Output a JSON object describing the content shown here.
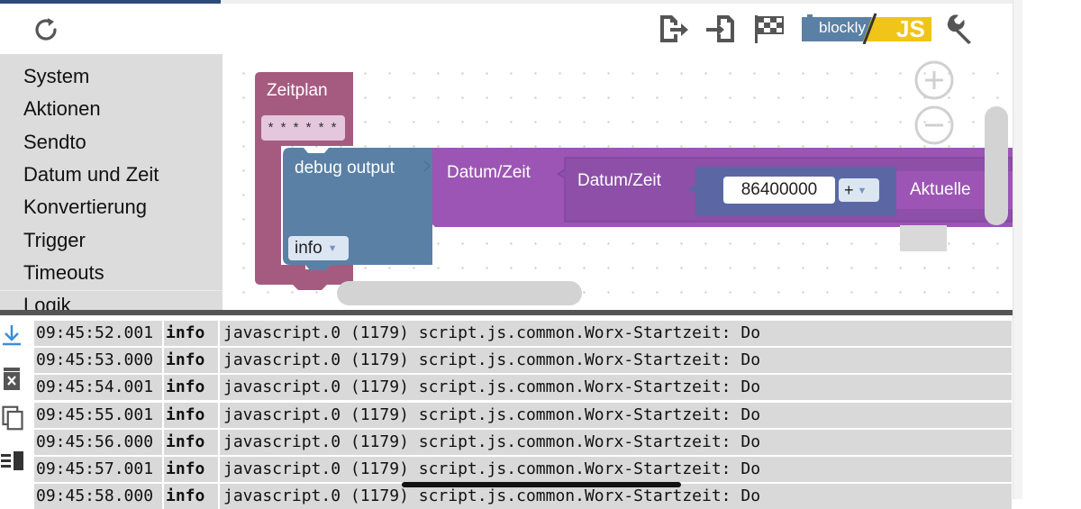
{
  "colors": {
    "zeitplan_block": "#a55b80",
    "debug_block": "#5b80a5",
    "datum_block": "#9c55b4",
    "datum_inner_block": "#8d4fa8",
    "math_block": "#5b67a5",
    "log_row_bg": "#d9d9d9",
    "sidebar_bg": "#dcdcdc",
    "blockly_badge": "#5b80a5",
    "js_badge": "#f0c419"
  },
  "toolbar": {
    "icons": [
      "refresh-icon",
      "export-icon",
      "import-icon",
      "checkered-flag-icon",
      "blockly-js-toggle-icon",
      "wrench-icon"
    ],
    "blockly_label": "blockly",
    "js_label": "JS"
  },
  "sidebar": {
    "items": [
      {
        "label": "System"
      },
      {
        "label": "Aktionen"
      },
      {
        "label": "Sendto"
      },
      {
        "label": "Datum und Zeit"
      },
      {
        "label": "Konvertierung"
      },
      {
        "label": "Trigger"
      },
      {
        "label": "Timeouts"
      },
      {
        "label": "Logik"
      }
    ]
  },
  "workspace": {
    "zeitplan": {
      "label": "Zeitplan",
      "cron": "* * * * * *"
    },
    "debug": {
      "label": "debug output",
      "level": "info"
    },
    "datum_outer": {
      "label": "Datum/Zeit"
    },
    "datum_inner": {
      "label": "Datum/Zeit"
    },
    "number": "86400000",
    "operator": "+",
    "aktuelle": {
      "label": "Aktuelle"
    }
  },
  "log": {
    "icons": [
      "scroll-down-icon",
      "clear-log-icon",
      "copy-icon",
      "toggle-view-icon"
    ],
    "rows": [
      {
        "time": "09:45:52.001",
        "level": "info",
        "message": "javascript.0 (1179) script.js.common.Worx-Startzeit: Do"
      },
      {
        "time": "09:45:53.000",
        "level": "info",
        "message": "javascript.0 (1179) script.js.common.Worx-Startzeit: Do"
      },
      {
        "time": "09:45:54.001",
        "level": "info",
        "message": "javascript.0 (1179) script.js.common.Worx-Startzeit: Do"
      },
      {
        "time": "09:45:55.001",
        "level": "info",
        "message": "javascript.0 (1179) script.js.common.Worx-Startzeit: Do"
      },
      {
        "time": "09:45:56.000",
        "level": "info",
        "message": "javascript.0 (1179) script.js.common.Worx-Startzeit: Do"
      },
      {
        "time": "09:45:57.001",
        "level": "info",
        "message": "javascript.0 (1179) script.js.common.Worx-Startzeit: Do"
      },
      {
        "time": "09:45:58.000",
        "level": "info",
        "message": "javascript.0 (1179) script.js.common.Worx-Startzeit: Do"
      }
    ]
  }
}
